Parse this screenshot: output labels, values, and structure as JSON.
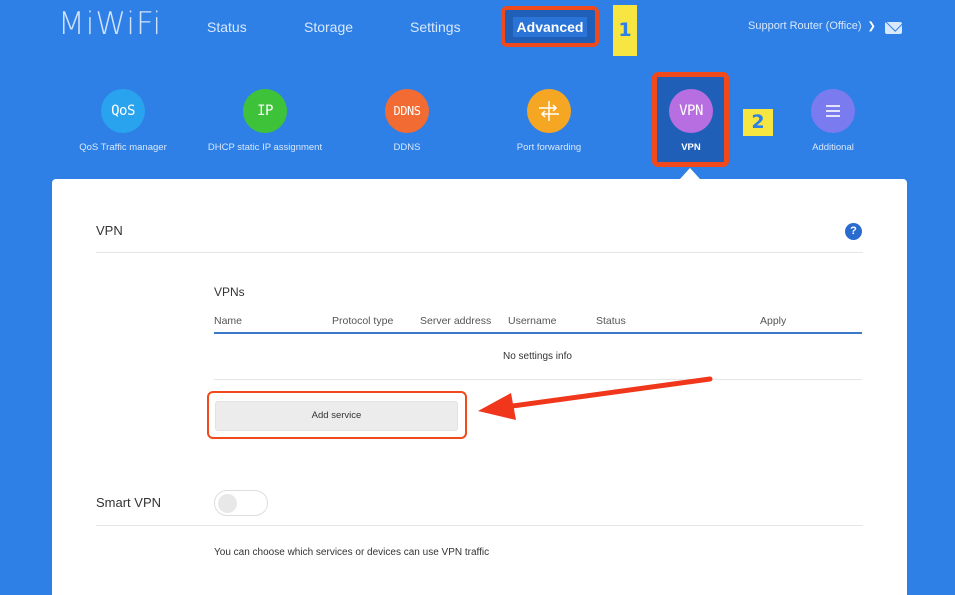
{
  "header": {
    "logo": "MiWiFi",
    "nav": [
      {
        "label": "Status"
      },
      {
        "label": "Storage"
      },
      {
        "label": "Settings"
      },
      {
        "label": "Advanced"
      }
    ],
    "badge_1": "1",
    "badge_2": "2",
    "account": "Support Router (Office)",
    "account_chevron_icon": "chevron-down-icon",
    "mail_icon": "mail-icon"
  },
  "features": [
    {
      "icon_text": "QoS",
      "label": "QoS Traffic manager",
      "color": "#2aa3ef"
    },
    {
      "icon_text": "IP",
      "label": "DHCP static IP assignment",
      "color": "#3ec23a"
    },
    {
      "icon_text": "DDNS",
      "label": "DDNS",
      "color": "#f26b33"
    },
    {
      "icon_text": "",
      "label": "Port forwarding",
      "color": "#f5a623"
    },
    {
      "icon_text": "VPN",
      "label": "VPN",
      "color": "#b76ee0"
    },
    {
      "icon_text": "",
      "label": "Additional",
      "color": "#7b7bf0"
    }
  ],
  "main": {
    "title": "VPN",
    "help_icon": "?",
    "vpns": {
      "title": "VPNs",
      "columns": [
        "Name",
        "Protocol type",
        "Server address",
        "Username",
        "Status",
        "Apply"
      ],
      "empty_text": "No settings info",
      "add_button": "Add service"
    },
    "smart_vpn": {
      "label": "Smart VPN",
      "enabled": false,
      "hint": "You can choose which services or devices can use VPN traffic"
    }
  },
  "colors": {
    "background": "#2e7fe6",
    "highlight": "#f04a1c",
    "badge": "#f7e641",
    "table_line": "#3b78c8"
  }
}
